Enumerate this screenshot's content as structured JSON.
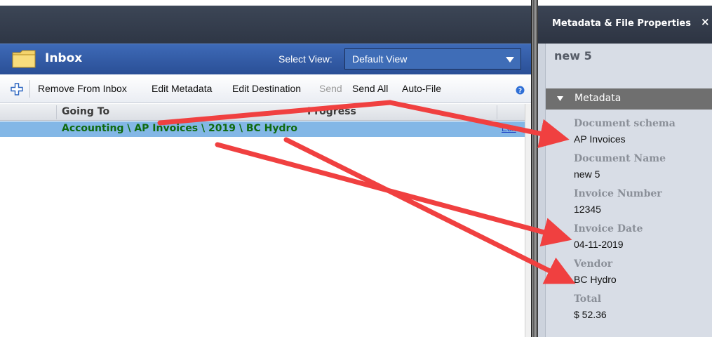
{
  "inbox": {
    "title": "Inbox",
    "select_view_label": "Select View:",
    "selected_view": "Default View"
  },
  "toolbar": {
    "remove_from_inbox": "Remove From Inbox",
    "edit_metadata": "Edit Metadata",
    "edit_destination": "Edit Destination",
    "send": "Send",
    "send_all": "Send All",
    "auto_file": "Auto-File"
  },
  "list": {
    "columns": {
      "going_to": "Going To",
      "progress": "Progress"
    },
    "rows": [
      {
        "destination": "Accounting \\ AP Invoices \\ 2019 \\ BC Hydro",
        "edit_link": "Edit"
      }
    ]
  },
  "properties": {
    "title": "Metadata & File Properties",
    "close": "×",
    "document_title": "new 5",
    "section_label": "Metadata",
    "fields": [
      {
        "label": "Document schema",
        "value": "AP Invoices"
      },
      {
        "label": "Document Name",
        "value": "new 5"
      },
      {
        "label": "Invoice Number",
        "value": "12345"
      },
      {
        "label": "Invoice Date",
        "value": "04-11-2019"
      },
      {
        "label": "Vendor",
        "value": "BC Hydro"
      },
      {
        "label": "Total",
        "value": "$ 52.36"
      }
    ]
  },
  "colors": {
    "inbox_header": "#2f5aa6",
    "selected_row": "#83b7e6",
    "destination_text": "#0f6a0f",
    "annotation_arrow": "#f04040",
    "section_header": "#6f6f6f"
  },
  "icons": {
    "folder": "folder-icon",
    "add": "plus-icon",
    "help": "help-icon",
    "dropdown": "chevron-down-icon",
    "caret": "caret-down-icon"
  }
}
